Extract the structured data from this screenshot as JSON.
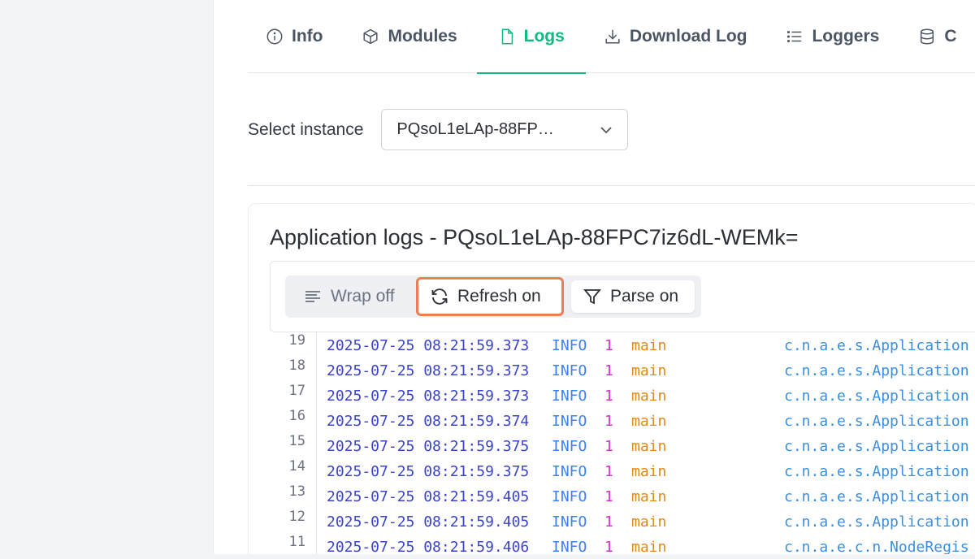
{
  "tabs": [
    {
      "label": "Info",
      "icon": "info-icon",
      "active": false
    },
    {
      "label": "Modules",
      "icon": "cube-icon",
      "active": false
    },
    {
      "label": "Logs",
      "icon": "file-icon",
      "active": true
    },
    {
      "label": "Download Log",
      "icon": "download-icon",
      "active": false
    },
    {
      "label": "Loggers",
      "icon": "list-icon",
      "active": false
    },
    {
      "label": "C",
      "icon": "database-icon",
      "active": false
    }
  ],
  "instance": {
    "label": "Select instance",
    "selected": "PQsoL1eLAp-88FP…"
  },
  "logs": {
    "title": "Application logs - PQsoL1eLAp-88FPC7iz6dL-WEMk=",
    "toolbar": {
      "wrap_label": "Wrap off",
      "refresh_label": "Refresh on",
      "parse_label": "Parse on"
    },
    "lines": [
      {
        "n": "19",
        "ts": "2025-07-25 08:21:59.373",
        "level": "INFO",
        "pid": "1",
        "thread": "main",
        "cls": "c.n.a.e.s.Application"
      },
      {
        "n": "18",
        "ts": "2025-07-25 08:21:59.373",
        "level": "INFO",
        "pid": "1",
        "thread": "main",
        "cls": "c.n.a.e.s.Application"
      },
      {
        "n": "17",
        "ts": "2025-07-25 08:21:59.373",
        "level": "INFO",
        "pid": "1",
        "thread": "main",
        "cls": "c.n.a.e.s.Application"
      },
      {
        "n": "16",
        "ts": "2025-07-25 08:21:59.374",
        "level": "INFO",
        "pid": "1",
        "thread": "main",
        "cls": "c.n.a.e.s.Application"
      },
      {
        "n": "15",
        "ts": "2025-07-25 08:21:59.375",
        "level": "INFO",
        "pid": "1",
        "thread": "main",
        "cls": "c.n.a.e.s.Application"
      },
      {
        "n": "14",
        "ts": "2025-07-25 08:21:59.375",
        "level": "INFO",
        "pid": "1",
        "thread": "main",
        "cls": "c.n.a.e.s.Application"
      },
      {
        "n": "13",
        "ts": "2025-07-25 08:21:59.405",
        "level": "INFO",
        "pid": "1",
        "thread": "main",
        "cls": "c.n.a.e.s.Application"
      },
      {
        "n": "12",
        "ts": "2025-07-25 08:21:59.405",
        "level": "INFO",
        "pid": "1",
        "thread": "main",
        "cls": "c.n.a.e.s.Application"
      },
      {
        "n": "11",
        "ts": "2025-07-25 08:21:59.406",
        "level": "INFO",
        "pid": "1",
        "thread": "main",
        "cls": "c.n.a.e.c.n.NodeRegis"
      }
    ]
  },
  "colors": {
    "accent": "#10b981",
    "highlight_border": "#ee7d4f"
  }
}
